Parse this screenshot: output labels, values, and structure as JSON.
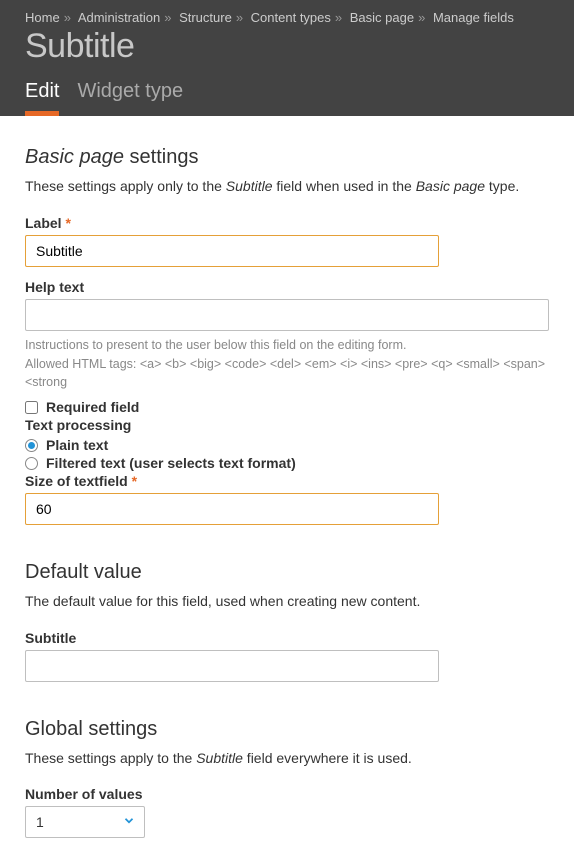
{
  "breadcrumb": [
    "Home",
    "Administration",
    "Structure",
    "Content types",
    "Basic page",
    "Manage fields"
  ],
  "page_title": "Subtitle",
  "tabs": {
    "edit": "Edit",
    "widget": "Widget type"
  },
  "section1": {
    "title_prefix": "Basic page",
    "title_suffix": " settings",
    "desc_pre": "These settings apply only to the ",
    "desc_field": "Subtitle",
    "desc_mid": " field when used in the ",
    "desc_type": "Basic page",
    "desc_post": " type."
  },
  "form": {
    "label_label": "Label",
    "label_value": "Subtitle",
    "help_label": "Help text",
    "help_value": "",
    "hint1": "Instructions to present to the user below this field on the editing form.",
    "hint2": "Allowed HTML tags: <a> <b> <big> <code> <del> <em> <i> <ins> <pre> <q> <small> <span> <strong",
    "required_label": "Required field",
    "textproc_label": "Text processing",
    "plain_label": "Plain text",
    "filtered_label": "Filtered text (user selects text format)",
    "size_label": "Size of textfield",
    "size_value": "60"
  },
  "section2": {
    "title": "Default value",
    "desc": "The default value for this field, used when creating new content.",
    "sub_label": "Subtitle",
    "sub_value": ""
  },
  "section3": {
    "title": "Global settings",
    "desc_pre": "These settings apply to the ",
    "desc_field": "Subtitle",
    "desc_post": " field everywhere it is used.",
    "num_label": "Number of values",
    "num_value": "1"
  }
}
